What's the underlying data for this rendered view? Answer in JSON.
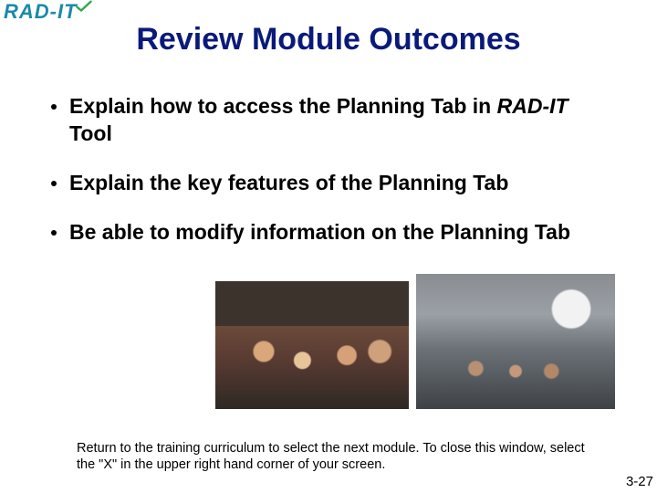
{
  "logo": {
    "text": "RAD-IT"
  },
  "title": "Review Module Outcomes",
  "bullets": [
    {
      "pre": "Explain how to access the Planning Tab in ",
      "ital": "RAD-IT",
      "post": " Tool"
    },
    {
      "pre": "Explain the key features of the Planning Tab",
      "ital": "",
      "post": ""
    },
    {
      "pre": "Be able to modify information on the Planning Tab",
      "ital": "",
      "post": ""
    }
  ],
  "footer": "Return to the training curriculum to select the next module. To close this window, select the \"X\" in the upper right hand corner of your screen.",
  "page": "3-27"
}
